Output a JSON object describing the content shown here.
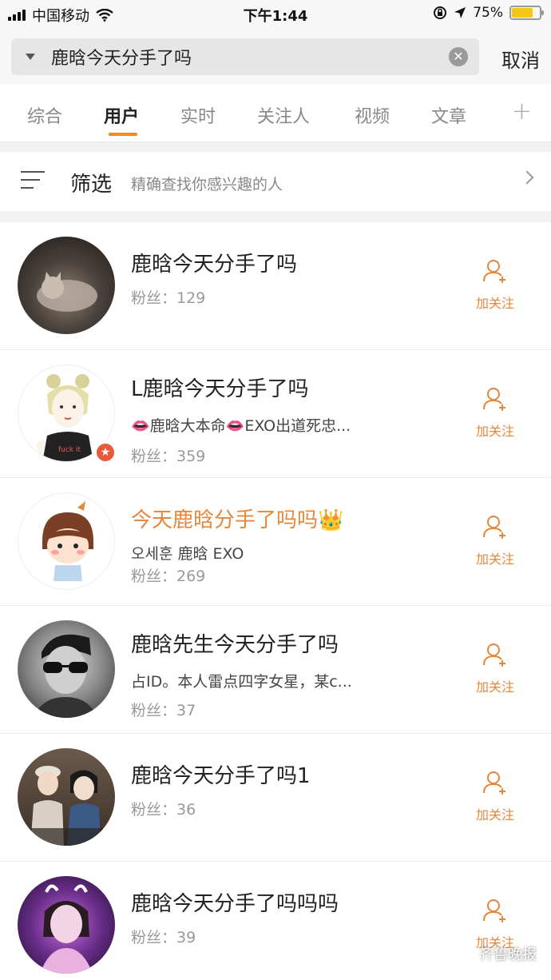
{
  "status_bar": {
    "carrier": "中国移动",
    "time": "下午1:44",
    "battery_percent": "75%",
    "battery_level": 0.75
  },
  "search": {
    "query": "鹿晗今天分手了吗",
    "cancel_label": "取消"
  },
  "tabs": [
    {
      "label": "综合"
    },
    {
      "label": "用户"
    },
    {
      "label": "实时"
    },
    {
      "label": "关注人"
    },
    {
      "label": "视频"
    },
    {
      "label": "文章"
    }
  ],
  "active_tab": "用户",
  "filter": {
    "title": "筛选",
    "description": "精确查找你感兴趣的人"
  },
  "follow_label": "加关注",
  "users": [
    {
      "name": "鹿晗今天分手了吗",
      "desc": "",
      "fans": "粉丝：129"
    },
    {
      "name": "L鹿晗今天分手了吗",
      "desc": "👄鹿晗大本命👄EXO出道死忠...",
      "fans": "粉丝：359"
    },
    {
      "name": "今天鹿晗分手了吗吗👑",
      "desc": "오세훈 鹿晗 EXO",
      "fans": "粉丝：269"
    },
    {
      "name": "鹿晗先生今天分手了吗",
      "desc": "占ID。本人雷点四字女星，某c...",
      "fans": "粉丝：37"
    },
    {
      "name": "鹿晗今天分手了吗1",
      "desc": "",
      "fans": "粉丝：36"
    },
    {
      "name": "鹿晗今天分手了吗吗吗",
      "desc": "",
      "fans": "粉丝：39"
    }
  ],
  "watermark": "齐鲁晚报",
  "colors": {
    "accent": "#e8863a",
    "tab_underline": "#f08a24",
    "battery": "#f5c518"
  }
}
